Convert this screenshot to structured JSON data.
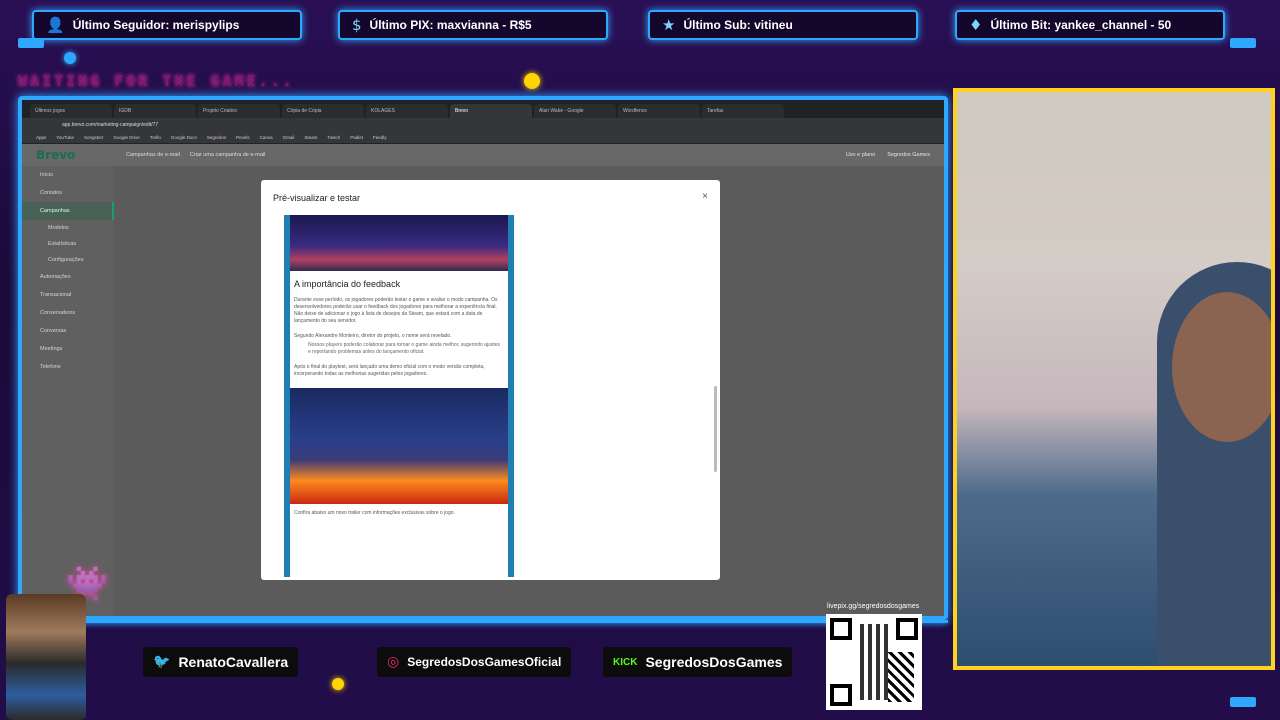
{
  "overlay": {
    "alerts": [
      {
        "icon": "person-icon",
        "text": "Último Seguidor: merispylips"
      },
      {
        "icon": "dollar-icon",
        "text": "Último PIX: maxvianna - R$5"
      },
      {
        "icon": "star-icon",
        "text": "Último Sub: vitineu"
      },
      {
        "icon": "diamond-icon",
        "text": "Último Bit: yankee_channel - 50"
      }
    ],
    "waiting_text": "WAITING FOR THE GAME...",
    "socials": [
      {
        "icon": "twitter-icon",
        "handle": "RenatoCavallera"
      },
      {
        "icon": "instagram-icon",
        "handle": "SegredosDosGamesOficial"
      },
      {
        "icon": "kick-icon",
        "icon_text": "KICK",
        "handle": "SegredosDosGames"
      }
    ],
    "qr_label": "livepix.gg/segredosdosgames",
    "accent": "#2ea7ff",
    "cam_border": "#ffd21f"
  },
  "browser": {
    "url": "app.brevo.com/marketing-campaign/edit/77",
    "tabs": [
      "Últimos jogos",
      "IGDB",
      "Projeto Criativo",
      "Cópia de Cópia",
      "KOLAGES",
      "Brevo",
      "Alan Wake - Google",
      "Wordfence",
      "Tarefas"
    ],
    "bookmarks": [
      "Apps",
      "YouTube",
      "Songsterr",
      "Google Drive",
      "Trello",
      "Google Docs",
      "Segredos",
      "Pexels",
      "Canva",
      "Gmail",
      "Steam",
      "Twitch",
      "Padlet",
      "Feedly"
    ]
  },
  "app": {
    "brand": "Brevo",
    "breadcrumb": [
      "Campanhas de e-mail",
      "Criar uma campanha de e-mail"
    ],
    "header_actions": [
      "Uso e plano",
      "Segredos Games"
    ],
    "sidebar": [
      {
        "label": "Início",
        "sub": false,
        "active": false
      },
      {
        "label": "Contatos",
        "sub": false,
        "active": false
      },
      {
        "label": "Campanhas",
        "sub": false,
        "active": true
      },
      {
        "label": "Modelos",
        "sub": true,
        "active": false
      },
      {
        "label": "Estatísticas",
        "sub": true,
        "active": false
      },
      {
        "label": "Configurações",
        "sub": true,
        "active": false
      },
      {
        "label": "Automações",
        "sub": false,
        "active": false
      },
      {
        "label": "Transacional",
        "sub": false,
        "active": false
      },
      {
        "label": "Conversations",
        "sub": false,
        "active": false
      },
      {
        "label": "Conversas",
        "sub": false,
        "active": false
      },
      {
        "label": "Meetings",
        "sub": false,
        "active": false
      },
      {
        "label": "Telefone",
        "sub": false,
        "active": false
      }
    ],
    "modal": {
      "title": "Pré-visualizar e testar",
      "close": "×",
      "heading": "A importância do feedback",
      "paragraph1": "Durante esse período, os jogadores poderão testar o game e avaliar o modo campanha. Os desenvolvedores poderão usar o feedback dos jogadores para melhorar a experiência final. Não deixe de adicionar o jogo à lista de desejos da Steam, que estará com a data de lançamento do seu servidor.",
      "paragraph2": "Segundo Alexandre Monteiro, diretor do projeto, o nome será revelado.",
      "quote": "Nossos players poderão colaborar para tornar o game ainda melhor, sugerindo ajustes e reportando problemas antes do lançamento oficial.",
      "paragraph3": "Após o final do playtest, será lançado uma demo oficial com o modo versão completa, incorporando todas as melhorias sugeridas pelos jogadores.",
      "footer": "Confira abaixo um novo trailer com informações exclusivas sobre o jogo."
    }
  }
}
